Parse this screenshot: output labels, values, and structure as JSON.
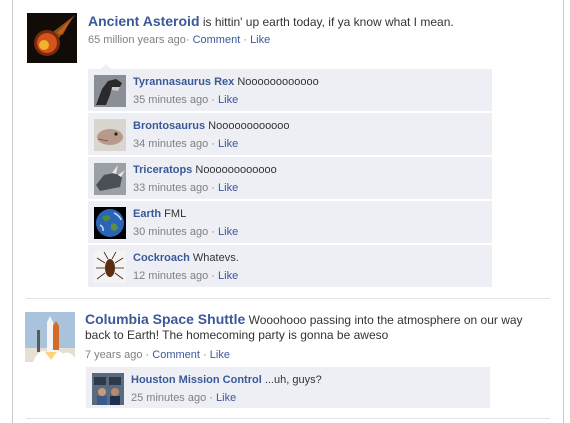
{
  "posts": [
    {
      "author": "Ancient Asteroid",
      "message": " is hittin' up earth today, if ya know what I mean.",
      "time": "65 million years ago",
      "comment_label": "Comment",
      "like_label": "Like",
      "comments": [
        {
          "author": "Tyrannasaurus Rex",
          "text": " Noooooooooooo",
          "time": "35 minutes ago",
          "like_label": "Like"
        },
        {
          "author": "Brontosaurus",
          "text": " Noooooooooooo",
          "time": "34 minutes ago",
          "like_label": "Like"
        },
        {
          "author": "Triceratops",
          "text": " Noooooooooooo",
          "time": "33 minutes ago",
          "like_label": "Like"
        },
        {
          "author": "Earth",
          "text": " FML",
          "time": "30 minutes ago",
          "like_label": "Like"
        },
        {
          "author": "Cockroach",
          "text": " Whatevs.",
          "time": "12 minutes ago",
          "like_label": "Like"
        }
      ]
    },
    {
      "author": "Columbia Space Shuttle",
      "message_line1": " Wooohooo passing into the atmosphere on our way",
      "message_line2": "back to Earth!  The homecoming party is gonna be aweso",
      "time": "7 years ago",
      "comment_label": "Comment",
      "like_label": "Like",
      "comments": [
        {
          "author": "Houston Mission Control",
          "text": " ...uh, guys?",
          "time": "25 minutes ago",
          "like_label": "Like"
        }
      ]
    }
  ],
  "separator": "·",
  "colors": {
    "link": "#3b5998",
    "comment_bg": "#edeff4",
    "meta": "#808080"
  }
}
